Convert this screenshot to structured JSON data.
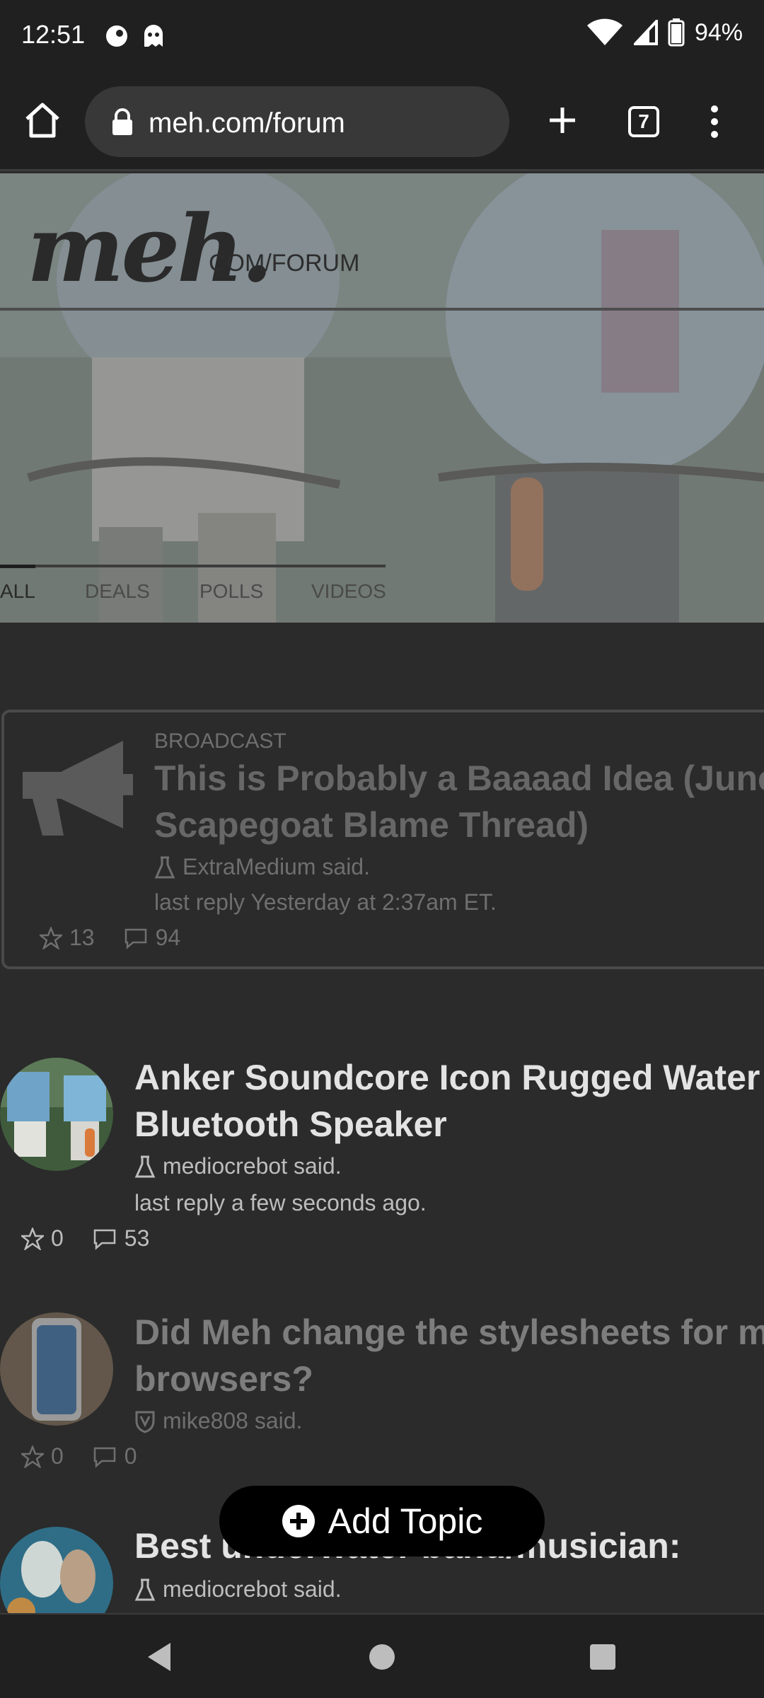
{
  "status_bar": {
    "time": "12:51",
    "battery": "94%"
  },
  "browser": {
    "url": "meh.com/forum",
    "tab_count": "7"
  },
  "hero": {
    "logo": "meh.",
    "logo_sub": "COM/FORUM",
    "tabs": [
      "ALL",
      "DEALS",
      "POLLS",
      "VIDEOS"
    ],
    "active_tab": "ALL"
  },
  "topics": [
    {
      "label": "BROADCAST",
      "title_line1": "This is Probably a Baaaad Idea (June",
      "title_line2": "Scapegoat Blame Thread)",
      "author": "ExtraMedium said.",
      "last_reply": "last reply Yesterday at 2:37am ET.",
      "stars": "13",
      "comments": "94"
    },
    {
      "title_line1": "Anker Soundcore Icon Rugged Water",
      "title_line2": "Bluetooth Speaker",
      "author": "mediocrebot said.",
      "last_reply": "last reply a few seconds ago.",
      "stars": "0",
      "comments": "53"
    },
    {
      "title_line1": "Did Meh change the stylesheets for m",
      "title_line2": "browsers?",
      "author": "mike808 said.",
      "stars": "0",
      "comments": "0"
    },
    {
      "title_line1": "Best underwater band/musician:",
      "author": "mediocrebot said."
    }
  ],
  "add_topic": {
    "label": "Add Topic"
  },
  "colors": {
    "background": "#2b2b2b",
    "bars": "#202020",
    "button": "#000000"
  }
}
